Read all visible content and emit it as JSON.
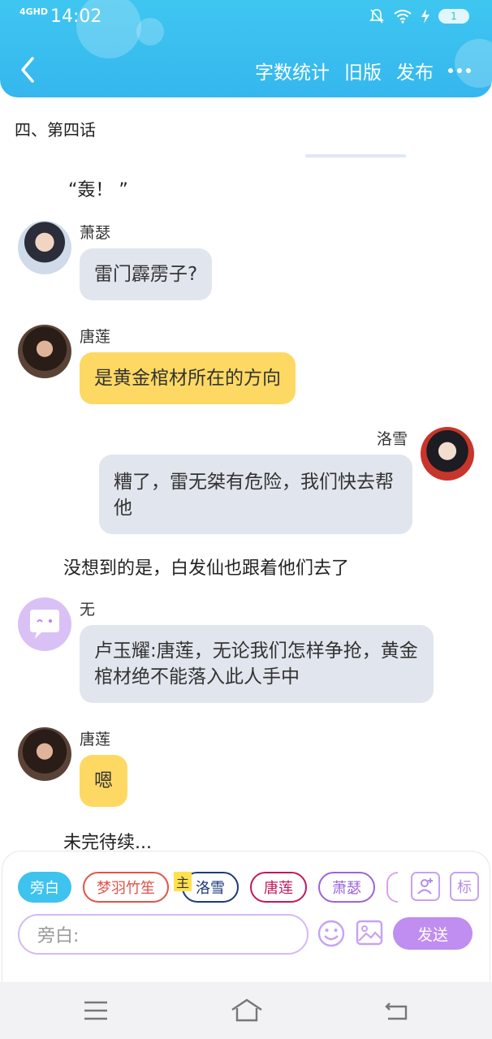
{
  "status_bar": {
    "signal": "4GHD",
    "time": "14:02",
    "battery": "1"
  },
  "header": {
    "actions": [
      "字数统计",
      "旧版",
      "发布"
    ]
  },
  "chapter": {
    "title": "四、第四话"
  },
  "messages": [
    {
      "kind": "narration",
      "text": "“轰！ ”"
    },
    {
      "kind": "chat",
      "name": "萧瑟",
      "text": "雷门霹雳子?",
      "color": "#e1e6ee"
    },
    {
      "kind": "chat",
      "name": "唐莲",
      "text": "是黄金棺材所在的方向",
      "color": "#fdd964"
    },
    {
      "kind": "chat",
      "name": "洛雪",
      "text": "糟了，雷无桀有危险，我们快去帮他",
      "color": "#e1e6ee"
    },
    {
      "kind": "narration",
      "text": "没想到的是，白发仙也跟着他们去了"
    },
    {
      "kind": "chat",
      "name": "无",
      "text": "卢玉耀:唐莲，无论我们怎样争抢，黄金棺材绝不能落入此人手中",
      "color": "#e1e6ee"
    },
    {
      "kind": "chat",
      "name": "唐莲",
      "text": "嗯",
      "color": "#fdd964"
    },
    {
      "kind": "narration",
      "text": "未完待续..."
    }
  ],
  "composer": {
    "chips": [
      {
        "label": "旁白",
        "color": "#3dc3ee"
      },
      {
        "label": "梦羽竹笙",
        "color": "#e0534a"
      },
      {
        "label": "洛雪",
        "color": "#1e3a7a"
      },
      {
        "label": "唐莲",
        "color": "#c2185b"
      },
      {
        "label": "萧瑟",
        "color": "#9c64d8"
      }
    ],
    "protagonist_tag": "主",
    "tag_button": "标",
    "input_placeholder": "旁白:",
    "send_label": "发送"
  }
}
